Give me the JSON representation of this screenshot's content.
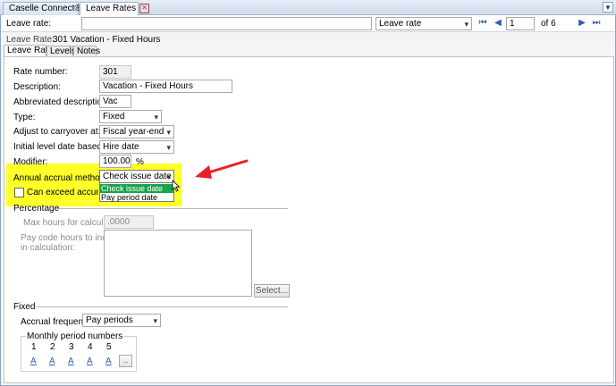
{
  "tabs": [
    {
      "label": "Caselle Connect®",
      "active": false
    },
    {
      "label": "Leave Rates",
      "active": true
    }
  ],
  "toolbar": {
    "field_label": "Leave rate:",
    "search_value": "",
    "mode_value": "Leave rate",
    "page_value": "1",
    "page_of": "of 6"
  },
  "header": {
    "label": "Leave Rate:",
    "value": "301 Vacation - Fixed Hours"
  },
  "subtabs": [
    "Leave Rate",
    "Levels",
    "Notes"
  ],
  "form": {
    "rate_number": {
      "label": "Rate number:",
      "value": "301"
    },
    "description": {
      "label": "Description:",
      "value": "Vacation - Fixed Hours"
    },
    "abbrev": {
      "label": "Abbreviated description:",
      "value": "Vac"
    },
    "type": {
      "label": "Type:",
      "value": "Fixed"
    },
    "carryover": {
      "label": "Adjust to carryover at:",
      "value": "Fiscal year-end"
    },
    "initial_level": {
      "label": "Initial level date based on:",
      "value": "Hire date"
    },
    "modifier": {
      "label": "Modifier:",
      "value": "100.00",
      "unit": "%"
    },
    "accrual_method": {
      "label": "Annual accrual method:",
      "value": "Check issue date",
      "options": [
        "Check issue date",
        "Pay period date"
      ],
      "selected_index": 0
    },
    "can_exceed": {
      "label": "Can exceed accumulatio",
      "checked": false
    }
  },
  "percentage": {
    "title": "Percentage",
    "max_hours_label": "Max hours for calculation:",
    "max_hours_value": ".0000",
    "pay_code_label_1": "Pay code hours to include",
    "pay_code_label_2": "in calculation:",
    "select_button": "Select..."
  },
  "fixed": {
    "title": "Fixed",
    "accrual_frequency_label": "Accrual frequency:",
    "accrual_frequency_value": "Pay periods",
    "monthly_title": "Monthly period numbers",
    "periods": [
      {
        "num": "1",
        "val": "A"
      },
      {
        "num": "2",
        "val": "A"
      },
      {
        "num": "3",
        "val": "A"
      },
      {
        "num": "4",
        "val": "A"
      },
      {
        "num": "5",
        "val": "A"
      }
    ],
    "more_button": ".."
  },
  "colors": {
    "highlight": "#ffff2a",
    "selected_option": "#19a34a",
    "arrow": "#e8202a"
  }
}
